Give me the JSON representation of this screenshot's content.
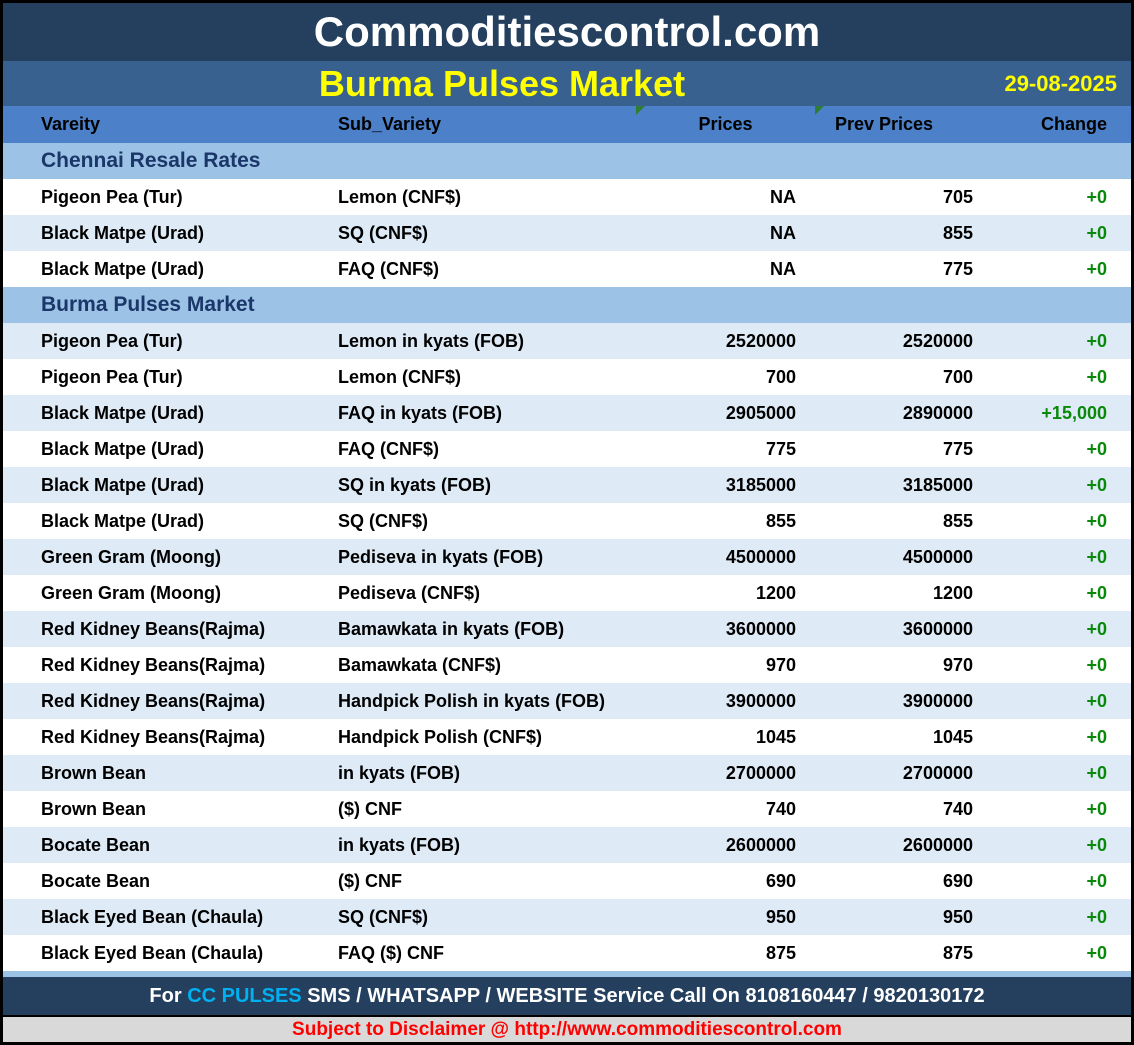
{
  "header": {
    "site_title": "Commoditiescontrol.com",
    "report_title": "Burma Pulses Market",
    "date": "29-08-2025"
  },
  "columns": [
    "Vareity",
    "Sub_Variety",
    "Prices",
    "Prev Prices",
    "Change"
  ],
  "sections": [
    {
      "title": "Chennai Resale Rates",
      "rows": [
        [
          "Pigeon Pea (Tur)",
          "Lemon (CNF$)",
          "NA",
          "705",
          "+0"
        ],
        [
          "Black Matpe (Urad)",
          "SQ (CNF$)",
          "NA",
          "855",
          "+0"
        ],
        [
          "Black Matpe (Urad)",
          "FAQ (CNF$)",
          "NA",
          "775",
          "+0"
        ]
      ]
    },
    {
      "title": "Burma Pulses Market",
      "rows": [
        [
          "Pigeon Pea (Tur)",
          "Lemon in kyats (FOB)",
          "2520000",
          "2520000",
          "+0"
        ],
        [
          "Pigeon Pea (Tur)",
          "Lemon (CNF$)",
          "700",
          "700",
          "+0"
        ],
        [
          "Black Matpe (Urad)",
          "FAQ in kyats (FOB)",
          "2905000",
          "2890000",
          "+15,000"
        ],
        [
          "Black Matpe (Urad)",
          "FAQ (CNF$)",
          "775",
          "775",
          "+0"
        ],
        [
          "Black Matpe (Urad)",
          "SQ in kyats (FOB)",
          "3185000",
          "3185000",
          "+0"
        ],
        [
          "Black Matpe (Urad)",
          "SQ (CNF$)",
          "855",
          "855",
          "+0"
        ],
        [
          "Green Gram (Moong)",
          "Pediseva in kyats (FOB)",
          "4500000",
          "4500000",
          "+0"
        ],
        [
          "Green Gram (Moong)",
          "Pediseva (CNF$)",
          "1200",
          "1200",
          "+0"
        ],
        [
          "Red Kidney Beans(Rajma)",
          "Bamawkata in kyats (FOB)",
          "3600000",
          "3600000",
          "+0"
        ],
        [
          "Red Kidney Beans(Rajma)",
          "Bamawkata (CNF$)",
          "970",
          "970",
          "+0"
        ],
        [
          "Red Kidney Beans(Rajma)",
          "Handpick Polish in kyats (FOB)",
          "3900000",
          "3900000",
          "+0"
        ],
        [
          "Red Kidney Beans(Rajma)",
          "Handpick Polish (CNF$)",
          "1045",
          "1045",
          "+0"
        ],
        [
          "Brown Bean",
          "in kyats (FOB)",
          "2700000",
          "2700000",
          "+0"
        ],
        [
          "Brown Bean",
          "($) CNF",
          "740",
          "740",
          "+0"
        ],
        [
          "Bocate Bean",
          "in kyats (FOB)",
          "2600000",
          "2600000",
          "+0"
        ],
        [
          "Bocate Bean",
          "($) CNF",
          "690",
          "690",
          "+0"
        ],
        [
          "Black Eyed Bean (Chaula)",
          "SQ (CNF$)",
          "950",
          "950",
          "+0"
        ],
        [
          "Black Eyed Bean (Chaula)",
          "FAQ ($) CNF",
          "875",
          "875",
          "+0"
        ]
      ]
    }
  ],
  "footer": {
    "service_prefix": "For ",
    "service_brand": "CC PULSES",
    "service_suffix": " SMS / WHATSAPP / WEBSITE Service Call On 8108160447 / 9820130172",
    "disclaimer": "Subject to Disclaimer @  http://www.commoditiescontrol.com"
  },
  "colors": {
    "header_navy": "#24405E",
    "subtitle_blue": "#38618F",
    "column_header_blue": "#4C81C9",
    "section_band_blue": "#9CC3E6",
    "alt_row_blue": "#DEEBF7",
    "title_yellow": "#FFFF00",
    "change_green": "#098909",
    "flag_green": "#2E7D32",
    "brand_cyan": "#00B0F0",
    "disclaimer_red": "#FF0000",
    "footer_gray": "#D9D9D9"
  }
}
